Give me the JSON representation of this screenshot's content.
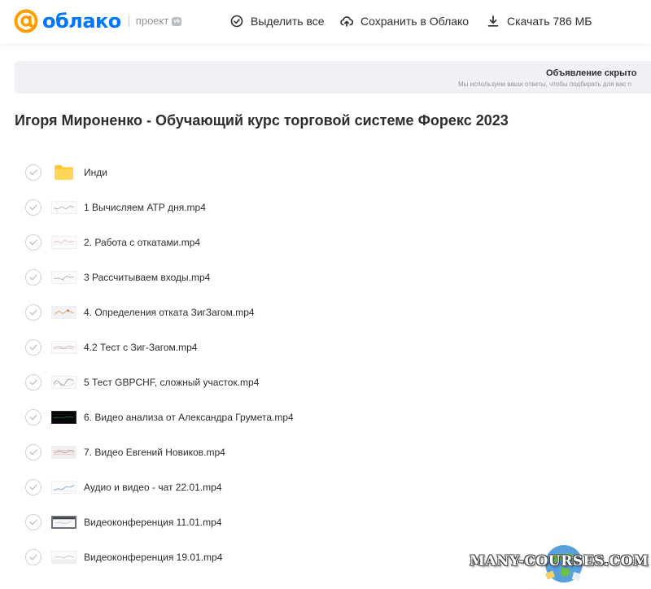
{
  "header": {
    "logo_text": "облако",
    "project_label": "проект",
    "vk_badge": "vk",
    "brand_color": "#0077ff",
    "actions": [
      {
        "label": "Выделить все",
        "icon": "check-circle-icon"
      },
      {
        "label": "Сохранить в Облако",
        "icon": "cloud-upload-icon"
      },
      {
        "label": "Скачать 786 МБ",
        "icon": "download-icon"
      }
    ]
  },
  "ad": {
    "title": "Объявление скрыто",
    "subtitle": "Мы используем ваши ответы, чтобы подбирать для вас п"
  },
  "page_title": "Игоря Мироненко - Обучающий курс торговой системе Форекс 2023",
  "files": [
    {
      "name": "Инди",
      "type": "folder"
    },
    {
      "name": "1 Вычисляем АТР дня.mp4",
      "type": "video"
    },
    {
      "name": "2. Работа с откатами.mp4",
      "type": "video"
    },
    {
      "name": "3 Рассчитываем входы.mp4",
      "type": "video"
    },
    {
      "name": "4. Определения отката ЗигЗагом.mp4",
      "type": "video"
    },
    {
      "name": "4.2 Тест с Зиг-Загом.mp4",
      "type": "video"
    },
    {
      "name": "5 Тест GBPCHF, сложный участок.mp4",
      "type": "video"
    },
    {
      "name": "6. Видео анализа от Александра Грумета.mp4",
      "type": "video"
    },
    {
      "name": "7. Видео Евгений Новиков.mp4",
      "type": "video"
    },
    {
      "name": "Аудио и видео - чат 22.01.mp4",
      "type": "video"
    },
    {
      "name": "Видеоконференция 11.01.mp4",
      "type": "video"
    },
    {
      "name": "Видеоконференция 19.01.mp4",
      "type": "video"
    }
  ],
  "watermark": {
    "text": "MANY-COURSES.COM"
  }
}
